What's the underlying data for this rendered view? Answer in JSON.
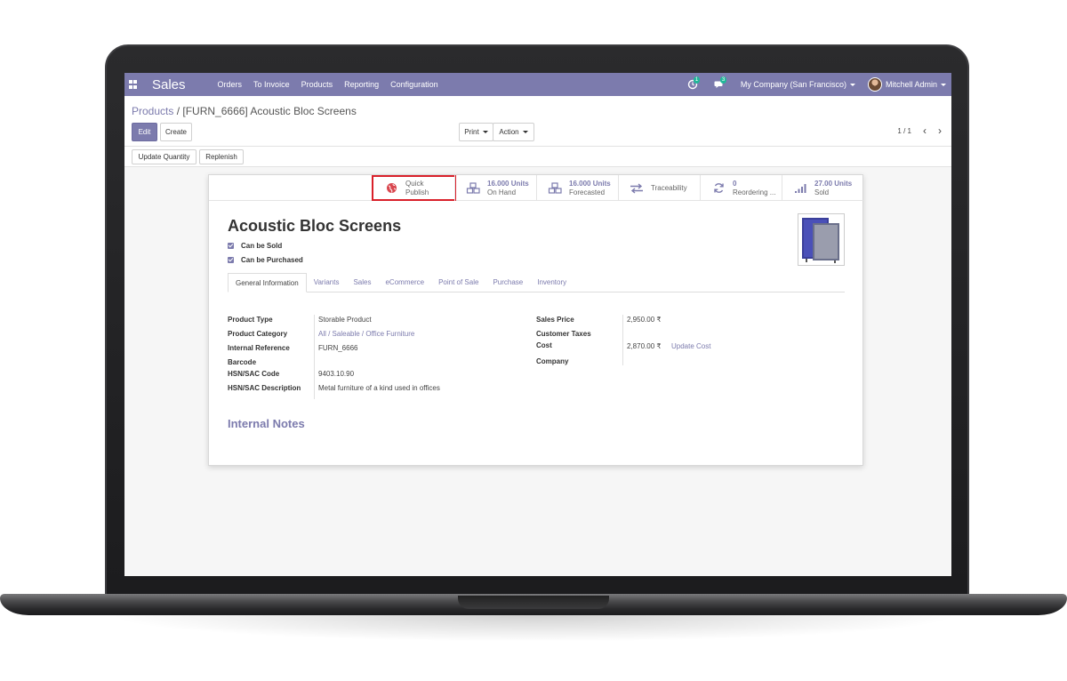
{
  "app": {
    "title": "Sales",
    "menu": [
      "Orders",
      "To Invoice",
      "Products",
      "Reporting",
      "Configuration"
    ],
    "activity_count": "1",
    "message_count": "3",
    "company": "My Company (San Francisco)",
    "user": "Mitchell Admin",
    "accent_color": "#7c7bad"
  },
  "breadcrumb": {
    "parent": "Products",
    "separator": "/",
    "current": "[FURN_6666] Acoustic Bloc Screens"
  },
  "toolbar": {
    "edit": "Edit",
    "create": "Create",
    "print": "Print",
    "action": "Action",
    "pager": "1 / 1",
    "update_quantity": "Update Quantity",
    "replenish": "Replenish"
  },
  "smart_buttons": [
    {
      "icon": "globe-icon",
      "line1": "Quick",
      "line2": "Publish"
    },
    {
      "icon": "cubes-icon",
      "line1": "16.000 Units",
      "line2": "On Hand"
    },
    {
      "icon": "cubes-icon",
      "line1": "16.000 Units",
      "line2": "Forecasted"
    },
    {
      "icon": "arrows-exchange-icon",
      "line1": "Traceability",
      "line2": ""
    },
    {
      "icon": "refresh-icon",
      "line1": "0",
      "line2": "Reordering ..."
    },
    {
      "icon": "bar-chart-icon",
      "line1": "27.00 Units",
      "line2": "Sold"
    }
  ],
  "product": {
    "name": "Acoustic Bloc Screens",
    "can_be_sold": "Can be Sold",
    "can_be_purchased": "Can be Purchased"
  },
  "tabs": [
    "General Information",
    "Variants",
    "Sales",
    "eCommerce",
    "Point of Sale",
    "Purchase",
    "Inventory"
  ],
  "left_fields": {
    "product_type_label": "Product Type",
    "product_type_value": "Storable Product",
    "product_category_label": "Product Category",
    "product_category_value": "All / Saleable / Office Furniture",
    "internal_reference_label": "Internal Reference",
    "internal_reference_value": "FURN_6666",
    "barcode_label": "Barcode",
    "hsn_code_label": "HSN/SAC Code",
    "hsn_code_value": "9403.10.90",
    "hsn_desc_label": "HSN/SAC Description",
    "hsn_desc_value": "Metal furniture of a kind used in offices"
  },
  "right_fields": {
    "sales_price_label": "Sales Price",
    "sales_price_value": "2,950.00 ₹",
    "customer_taxes_label": "Customer Taxes",
    "cost_label": "Cost",
    "cost_value": "2,870.00 ₹",
    "update_cost": "Update Cost",
    "company_label": "Company"
  },
  "internal_notes": "Internal Notes"
}
